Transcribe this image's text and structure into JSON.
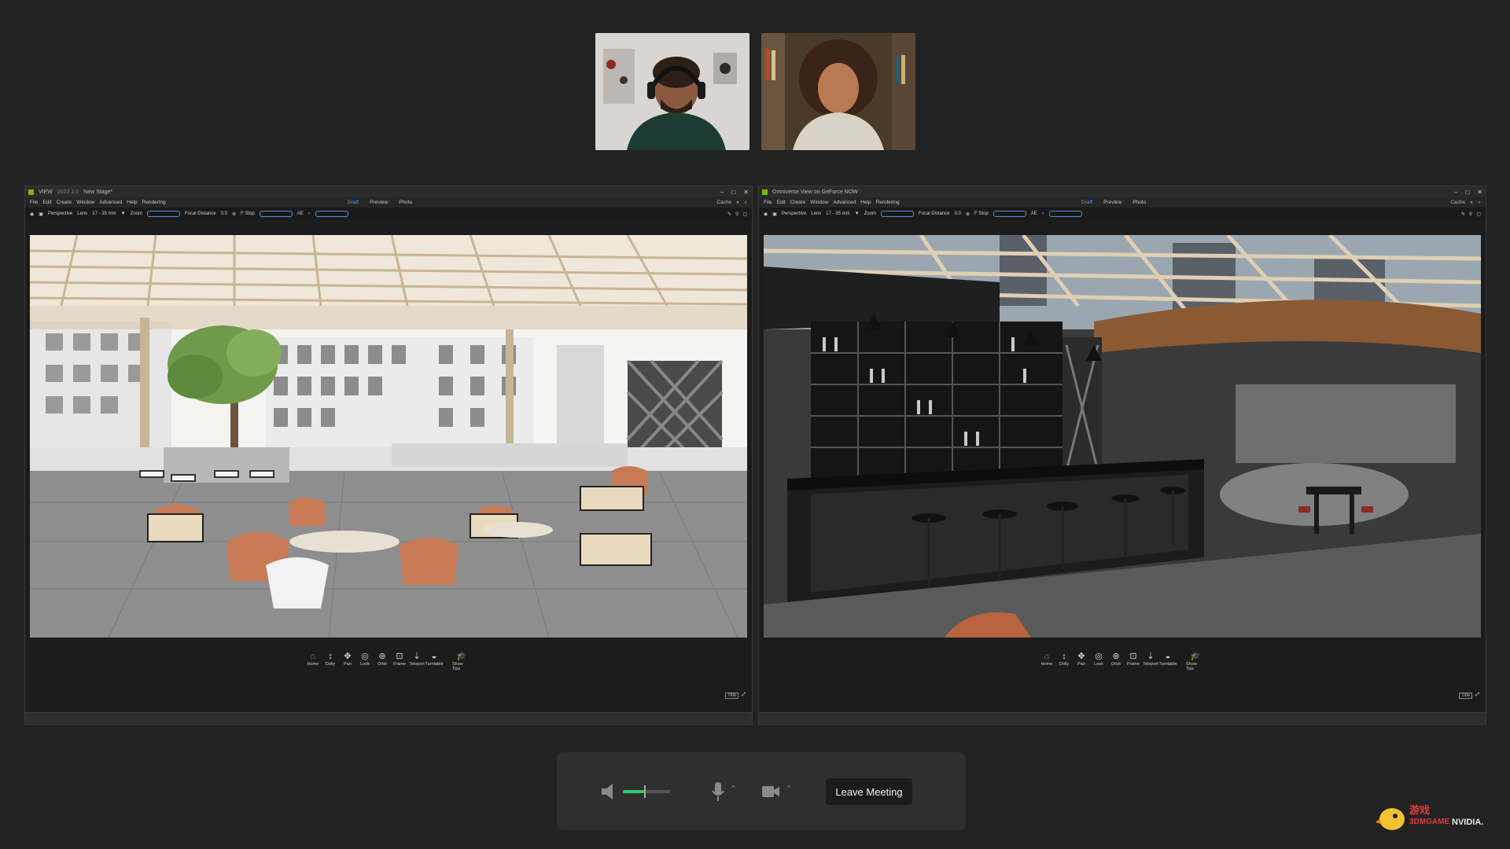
{
  "meeting": {
    "leave_label": "Leave Meeting"
  },
  "windows": [
    {
      "title_app": "VIEW",
      "title_version": "2022.1.0",
      "title_stage": "New Stage*",
      "menu": [
        "File",
        "Edit",
        "Create",
        "Window",
        "Advanced",
        "Help",
        "Rendering"
      ],
      "modes": [
        "Draft",
        "Preview",
        "Photo"
      ],
      "active_mode": "Draft",
      "cache": "Cache",
      "toolbar": {
        "camera": "Perspective",
        "lens_label": "Lens",
        "lens_value": "17 - 35 mm",
        "zoom_label": "Zoom",
        "focal_label": "Focal Distance",
        "focal_value": "0.0",
        "fstop_label": "F Stop",
        "ae": "AE"
      }
    },
    {
      "title_app": "Omniverse View on GeForce NOW",
      "menu": [
        "File",
        "Edit",
        "Create",
        "Window",
        "Advanced",
        "Help",
        "Rendering"
      ],
      "modes": [
        "Draft",
        "Preview",
        "Photo"
      ],
      "active_mode": "Draft",
      "cache": "Cache",
      "toolbar": {
        "camera": "Perspective",
        "lens_label": "Lens",
        "lens_value": "17 - 35 mm",
        "zoom_label": "Zoom",
        "focal_label": "Focal Distance",
        "focal_value": "0.0",
        "fstop_label": "F Stop",
        "ae": "AE"
      }
    }
  ],
  "nav_tools": [
    {
      "label": "Home",
      "icon": "home-icon"
    },
    {
      "label": "Dolly",
      "icon": "dolly-icon"
    },
    {
      "label": "Pan",
      "icon": "pan-icon"
    },
    {
      "label": "Look",
      "icon": "look-icon"
    },
    {
      "label": "Orbit",
      "icon": "orbit-icon"
    },
    {
      "label": "Frame",
      "icon": "frame-icon"
    },
    {
      "label": "Teleport",
      "icon": "teleport-icon"
    },
    {
      "label": "Turntable",
      "icon": "turntable-icon"
    },
    {
      "label": "Show Tips",
      "icon": "graduation-cap-icon"
    }
  ],
  "corner_label": "Title",
  "watermark": {
    "line1": "游戏",
    "line2": "3DMGAME",
    "brand": "NVIDIA."
  },
  "colors": {
    "accent": "#4ba3ff",
    "volume": "#2ecc71",
    "background": "#222222"
  }
}
